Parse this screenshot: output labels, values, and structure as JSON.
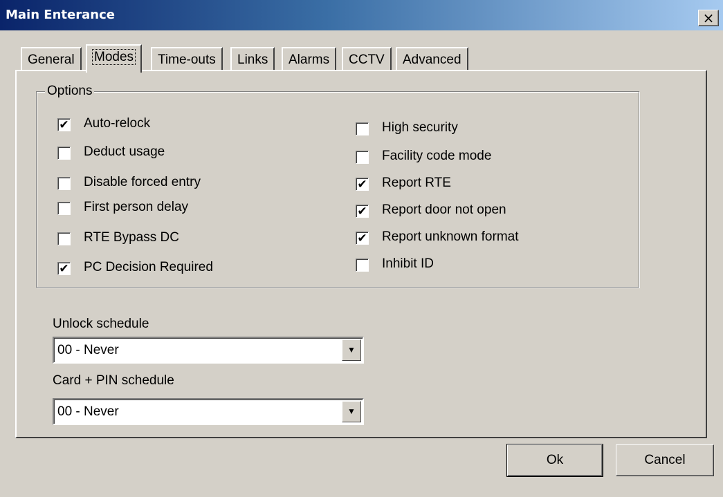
{
  "window": {
    "title": "Main Enterance",
    "close_glyph": "×"
  },
  "tabs": [
    {
      "label": "General"
    },
    {
      "label": "Modes"
    },
    {
      "label": "Time-outs"
    },
    {
      "label": "Links"
    },
    {
      "label": "Alarms"
    },
    {
      "label": "CCTV"
    },
    {
      "label": "Advanced"
    }
  ],
  "active_tab": "Modes",
  "options": {
    "legend": "Options",
    "left": [
      {
        "label": "Auto-relock",
        "checked": true
      },
      {
        "label": "Deduct usage",
        "checked": false
      },
      {
        "label": "Disable forced entry",
        "checked": false
      },
      {
        "label": "First person delay",
        "checked": false
      },
      {
        "label": "RTE Bypass DC",
        "checked": false
      },
      {
        "label": "PC Decision Required",
        "checked": true
      }
    ],
    "right": [
      {
        "label": "High security",
        "checked": false
      },
      {
        "label": "Facility code mode",
        "checked": false
      },
      {
        "label": "Report RTE",
        "checked": true
      },
      {
        "label": "Report door not open",
        "checked": true
      },
      {
        "label": "Report unknown format",
        "checked": true
      },
      {
        "label": "Inhibit ID",
        "checked": false
      }
    ]
  },
  "unlock_schedule": {
    "label": "Unlock schedule",
    "value": "00 - Never"
  },
  "card_pin_schedule": {
    "label": "Card + PIN schedule",
    "value": "00 - Never"
  },
  "buttons": {
    "ok": "Ok",
    "cancel": "Cancel"
  },
  "glyphs": {
    "check": "✔",
    "dropdown": "▼"
  },
  "colors": {
    "dialog_bg": "#d4d0c8",
    "title_start": "#0a246a",
    "title_end": "#a6caf0"
  }
}
